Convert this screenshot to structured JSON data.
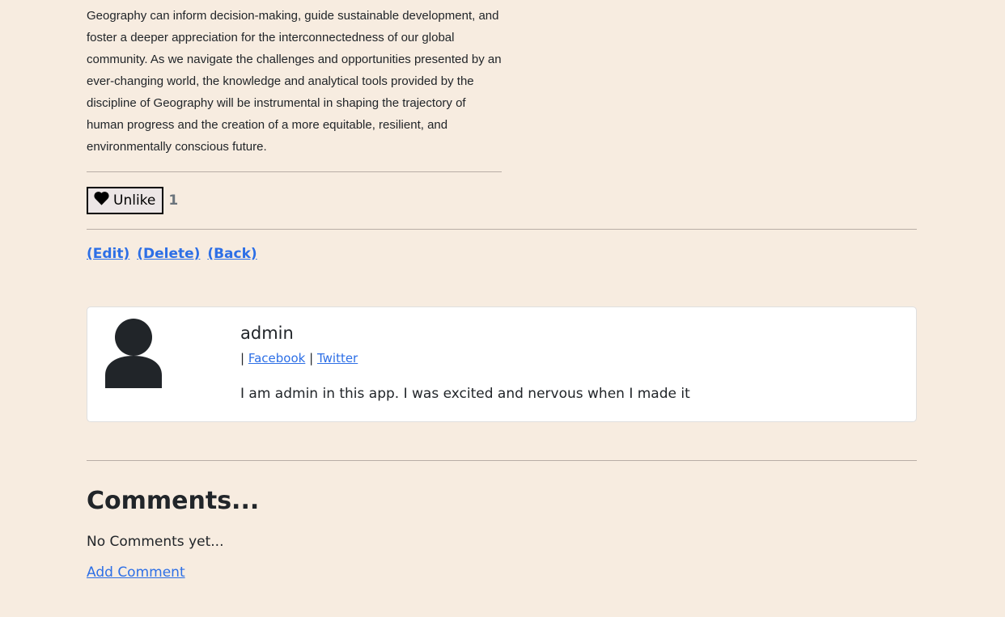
{
  "article": {
    "paragraph": "Geography can inform decision-making, guide sustainable development, and foster a deeper appreciation for the interconnectedness of our global community. As we navigate the challenges and opportunities presented by an ever-changing world, the knowledge and analytical tools provided by the discipline of Geography will be instrumental in shaping the trajectory of human progress and the creation of a more equitable, resilient, and environmentally conscious future."
  },
  "like": {
    "icon": "heart-icon",
    "label": "Unlike",
    "count": "1"
  },
  "actions": {
    "edit": "(Edit)",
    "delete": "(Delete)",
    "back": "(Back)"
  },
  "author": {
    "name": "admin",
    "separator": "|",
    "facebook": "Facebook",
    "twitter": "Twitter",
    "bio": "I am admin in this app. I was excited and nervous when I made it",
    "avatar_icon": "user-silhouette-icon"
  },
  "comments": {
    "title": "Comments...",
    "empty": "No Comments yet...",
    "add": "Add Comment"
  },
  "colors": {
    "background": "#f7ece0",
    "link": "#2d6fe6",
    "card": "#ffffff"
  }
}
